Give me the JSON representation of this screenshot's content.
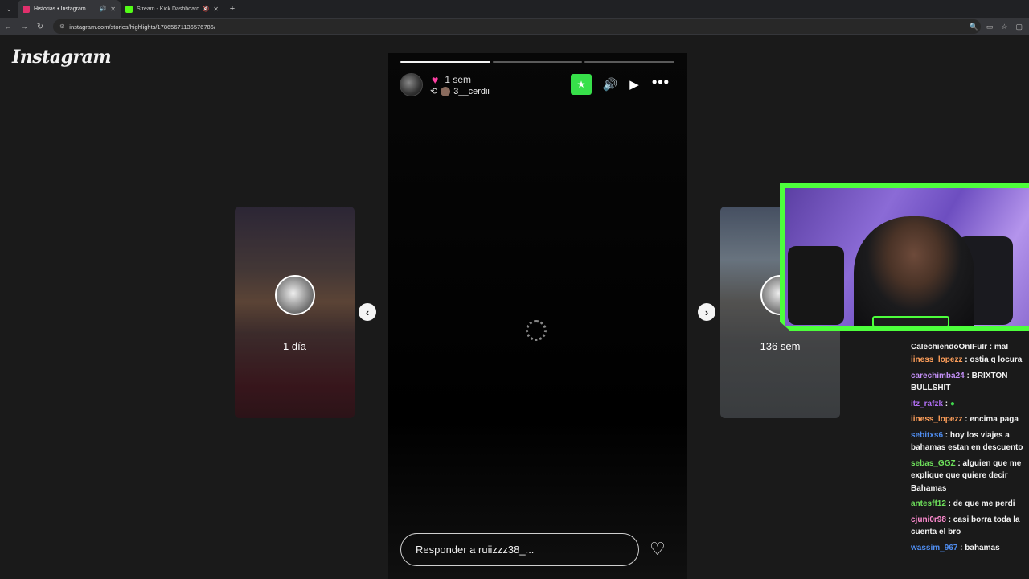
{
  "browser": {
    "tabs": [
      {
        "title": "Historias • Instagram",
        "active": true,
        "favicon_color": "#e1306c"
      },
      {
        "title": "Stream - Kick Dashboard",
        "active": false,
        "favicon_color": "#53fc18"
      }
    ],
    "url": "instagram.com/stories/highlights/17865671136576786/"
  },
  "logo": "Instagram",
  "story": {
    "time": "1 sem",
    "username": "3__cerdii",
    "reply_placeholder": "Responder a ruiizzz38_..."
  },
  "previews": {
    "left_time": "1 día",
    "right_time": "136 sem"
  },
  "chat": {
    "partial_top": "CalechiendoOnlFulr : mal",
    "messages": [
      {
        "user": "iiness_lopezz",
        "color": "#ff9f5a",
        "text": " : ostia q locura"
      },
      {
        "user": "carechimba24",
        "color": "#c28ff5",
        "text": " : BRIXTON BULLSHIT"
      },
      {
        "user": "itz_rafzk",
        "color": "#b06ef3",
        "text": " : "
      },
      {
        "user": "iiness_lopezz",
        "color": "#ff9f5a",
        "text": " : encima paga"
      },
      {
        "user": "sebitxs6",
        "color": "#4f8df0",
        "text": " : hoy los viajes a bahamas estan en descuento"
      },
      {
        "user": "sebas_GGZ",
        "color": "#6ee05b",
        "text": " : alguien que me explique que quiere decir Bahamas"
      },
      {
        "user": "antesff12",
        "color": "#6ee05b",
        "text": " : de que me perdi"
      },
      {
        "user": "cjuni0r98",
        "color": "#ff8bd0",
        "text": " : casi borra toda la cuenta el bro"
      },
      {
        "user": "wassim_967",
        "color": "#4f8df0",
        "text": " : bahamas"
      }
    ]
  }
}
